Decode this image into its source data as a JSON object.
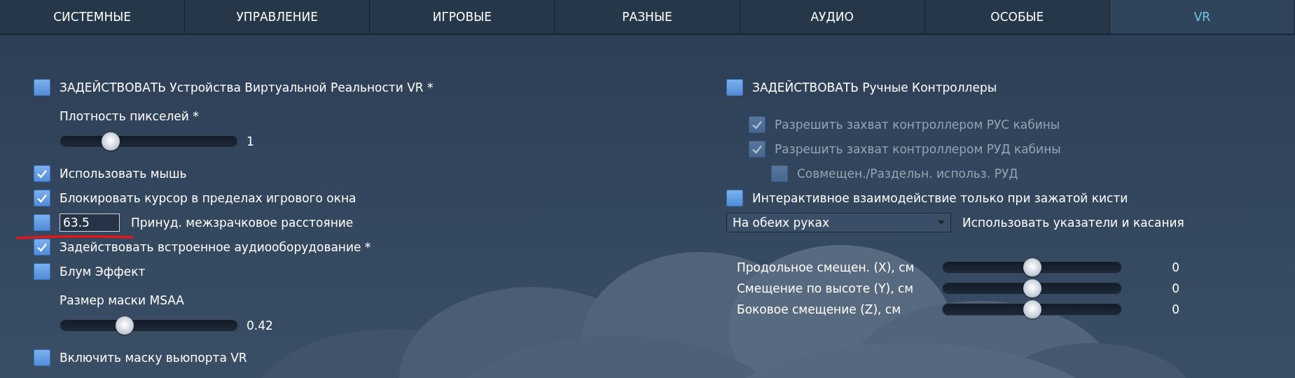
{
  "tabs": [
    {
      "label": "СИСТЕМНЫЕ",
      "selected": false
    },
    {
      "label": "УПРАВЛЕНИЕ",
      "selected": false
    },
    {
      "label": "ИГРОВЫЕ",
      "selected": false
    },
    {
      "label": "РАЗНЫЕ",
      "selected": false
    },
    {
      "label": "АУДИО",
      "selected": false
    },
    {
      "label": "ОСОБЫЕ",
      "selected": false
    },
    {
      "label": "VR",
      "selected": true
    }
  ],
  "left": [
    {
      "kind": "checkbox",
      "label": "ЗАДЕЙСТВОВАТЬ Устройства Виртуальной Реальности VR *",
      "checked": false,
      "disabled": false
    },
    {
      "kind": "label",
      "label": "Плотность пикселей *"
    },
    {
      "kind": "slider",
      "level": 0.26,
      "reading": "1"
    },
    {
      "kind": "checkbox",
      "label": "Использовать мышь",
      "checked": true,
      "disabled": false
    },
    {
      "kind": "checkbox",
      "label": "Блокировать курсор в пределах игрового окна",
      "checked": true,
      "disabled": false
    },
    {
      "kind": "input_checkbox",
      "checked": false,
      "field_text": "63.5",
      "label": "Принуд. межзрачковое расстояние"
    },
    {
      "kind": "checkbox",
      "label": "Задействовать встроенное аудиооборудование *",
      "checked": true,
      "disabled": false
    },
    {
      "kind": "checkbox",
      "label": "Блум Эффект",
      "checked": false,
      "disabled": false
    },
    {
      "kind": "label",
      "label": "Размер маски MSAA"
    },
    {
      "kind": "slider",
      "level": 0.35,
      "reading": "0.42"
    },
    {
      "kind": "checkbox",
      "label": "Включить маску вьюпорта VR",
      "checked": false,
      "disabled": false
    }
  ],
  "right": [
    {
      "kind": "checkbox",
      "label": "ЗАДЕЙСТВОВАТЬ Ручные Контроллеры",
      "checked": false,
      "disabled": false,
      "children": [
        {
          "kind": "checkbox",
          "label": "Разрешить захват контроллером РУС кабины",
          "checked": true,
          "disabled": true
        },
        {
          "kind": "checkbox",
          "label": "Разрешить захват контроллером РУД кабины",
          "checked": true,
          "disabled": true,
          "children": [
            {
              "kind": "checkbox",
              "label": "Совмещен./Раздельн. использ. РУД",
              "checked": false,
              "disabled": true
            }
          ]
        }
      ]
    },
    {
      "kind": "checkbox",
      "label": "Интерактивное взаимодействие только при зажатой кисти",
      "checked": false,
      "disabled": false
    },
    {
      "kind": "dropdown",
      "selection": "На обеих руках",
      "label": "Использовать указатели и касания"
    }
  ],
  "offsets": [
    {
      "label": "Продольное смещен. (X), см",
      "level": 0.5,
      "reading": "0"
    },
    {
      "label": "Смещение по высоте (Y), см",
      "level": 0.5,
      "reading": "0"
    },
    {
      "label": "Боковое смещение (Z), см",
      "level": 0.5,
      "reading": "0"
    }
  ]
}
